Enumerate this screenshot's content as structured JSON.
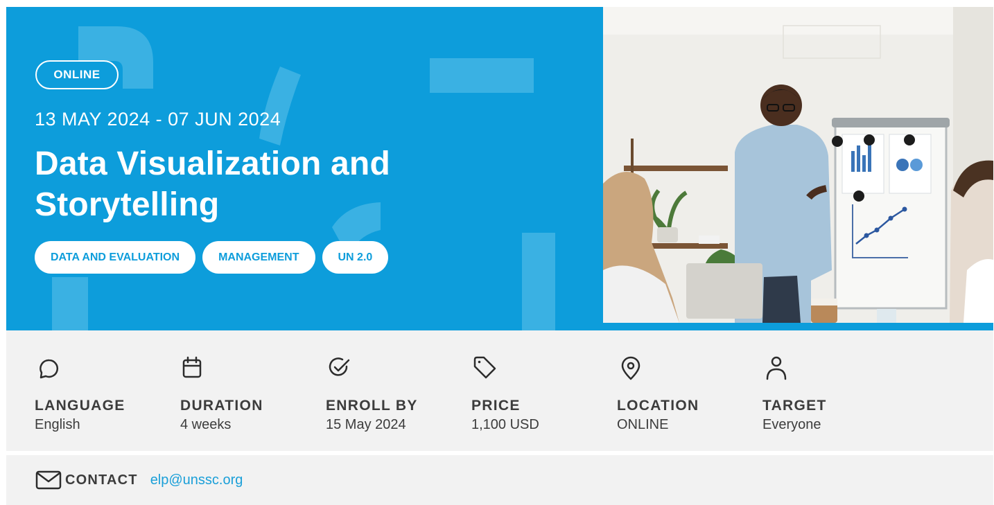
{
  "course": {
    "mode": "ONLINE",
    "dates": "13 MAY 2024 - 07 JUN 2024",
    "title": "Data Visualization and Storytelling",
    "tags": [
      "DATA AND EVALUATION",
      "MANAGEMENT",
      "UN 2.0"
    ],
    "hero_image": "presenter-at-flipchart-photo"
  },
  "info": [
    {
      "label": "LANGUAGE",
      "value": "English",
      "icon": "speech-bubble-icon"
    },
    {
      "label": "DURATION",
      "value": "4 weeks",
      "icon": "calendar-icon"
    },
    {
      "label": "ENROLL BY",
      "value": "15 May 2024",
      "icon": "check-circle-icon"
    },
    {
      "label": "PRICE",
      "value": "1,100 USD",
      "icon": "price-tag-icon"
    },
    {
      "label": "LOCATION",
      "value": "ONLINE",
      "icon": "map-pin-icon"
    },
    {
      "label": "TARGET",
      "value": "Everyone",
      "icon": "person-icon"
    }
  ],
  "contact": {
    "label": "CONTACT",
    "email": "elp@unssc.org",
    "icon": "envelope-icon"
  },
  "colors": {
    "brand_blue": "#0d9ddb",
    "info_background": "#f2f2f2",
    "text_dark": "#3c3c3c",
    "link_blue": "#1a9fd8"
  }
}
